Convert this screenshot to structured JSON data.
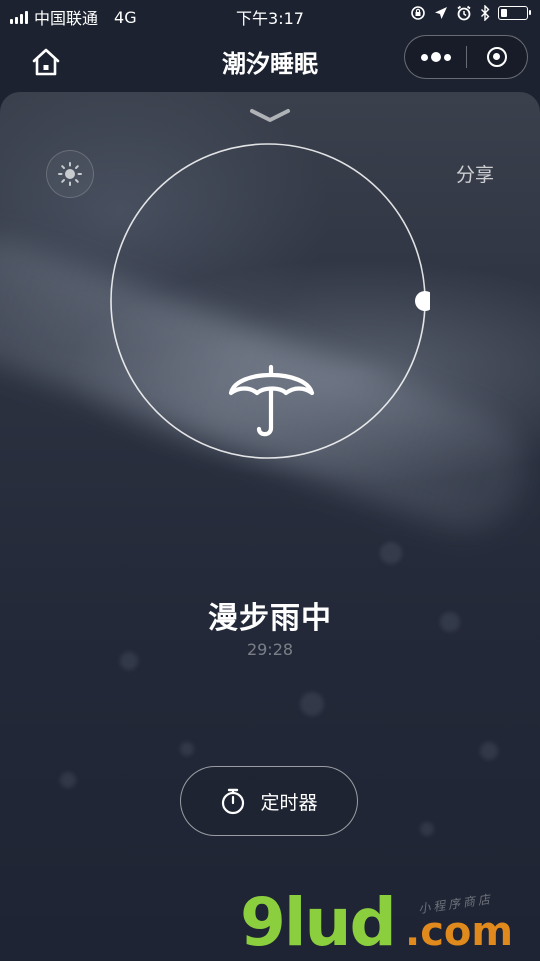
{
  "status_bar": {
    "carrier": "中国联通",
    "network": "4G",
    "time": "下午3:17",
    "battery_level": 0.25
  },
  "nav": {
    "title": "潮汐睡眠",
    "home_icon": "home-icon",
    "more_icon": "more-icon",
    "close_icon": "close-target-icon"
  },
  "panel": {
    "share_label": "分享",
    "brightness_icon": "brightness-icon",
    "collapse_icon": "chevron-down-icon"
  },
  "player": {
    "scene_icon": "umbrella-icon",
    "scene_name": "漫步雨中",
    "time_display": "29:28",
    "progress": 0.0
  },
  "timer": {
    "label": "定时器",
    "icon": "stopwatch-icon"
  },
  "watermark": {
    "logo_main": "9lud",
    "logo_tld": ".com",
    "logo_sub": "小程序商店"
  },
  "colors": {
    "background": "#1c2230",
    "text": "#ffffff",
    "watermark_green": "#8ccf3e",
    "watermark_orange": "#e08a1e"
  }
}
